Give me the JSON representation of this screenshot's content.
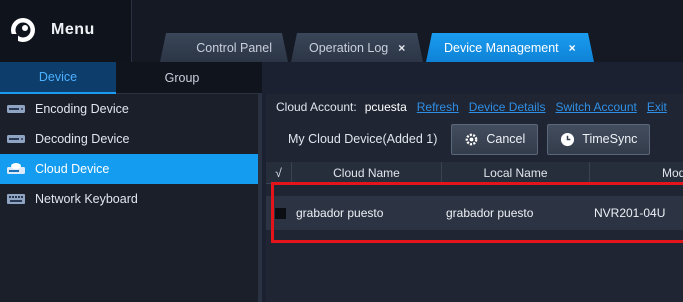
{
  "app": {
    "menu_label": "Menu",
    "logo_icon": "eye-logo-icon"
  },
  "tabs": [
    {
      "label": "Control Panel",
      "closable": false,
      "active": false
    },
    {
      "label": "Operation Log",
      "closable": true,
      "active": false
    },
    {
      "label": "Device Management",
      "closable": true,
      "active": true
    }
  ],
  "tab_close_glyph": "×",
  "left_tabs": [
    {
      "label": "Device",
      "active": true
    },
    {
      "label": "Group",
      "active": false
    }
  ],
  "sidebar": {
    "items": [
      {
        "label": "Encoding Device",
        "icon": "encoding-device-icon",
        "active": false
      },
      {
        "label": "Decoding Device",
        "icon": "decoding-device-icon",
        "active": false
      },
      {
        "label": "Cloud Device",
        "icon": "cloud-device-icon",
        "active": true
      },
      {
        "label": "Network Keyboard",
        "icon": "keyboard-icon",
        "active": false
      }
    ]
  },
  "account": {
    "label": "Cloud Account:",
    "username": "pcuesta",
    "links": [
      "Refresh",
      "Device Details",
      "Switch Account",
      "Exit"
    ]
  },
  "device_bar": {
    "title": "My Cloud Device(Added 1)",
    "cancel_label": "Cancel",
    "timesync_label": "TimeSync"
  },
  "table": {
    "columns": [
      "√",
      "Cloud Name",
      "Local Name",
      "Mode"
    ],
    "rows": [
      {
        "cloud_name": "grabador puesto",
        "local_name": "grabador puesto",
        "model": "NVR201-04U"
      }
    ]
  },
  "colors": {
    "accent": "#139cf0",
    "highlight_box": "#e4141b",
    "link": "#2f8fe6"
  }
}
